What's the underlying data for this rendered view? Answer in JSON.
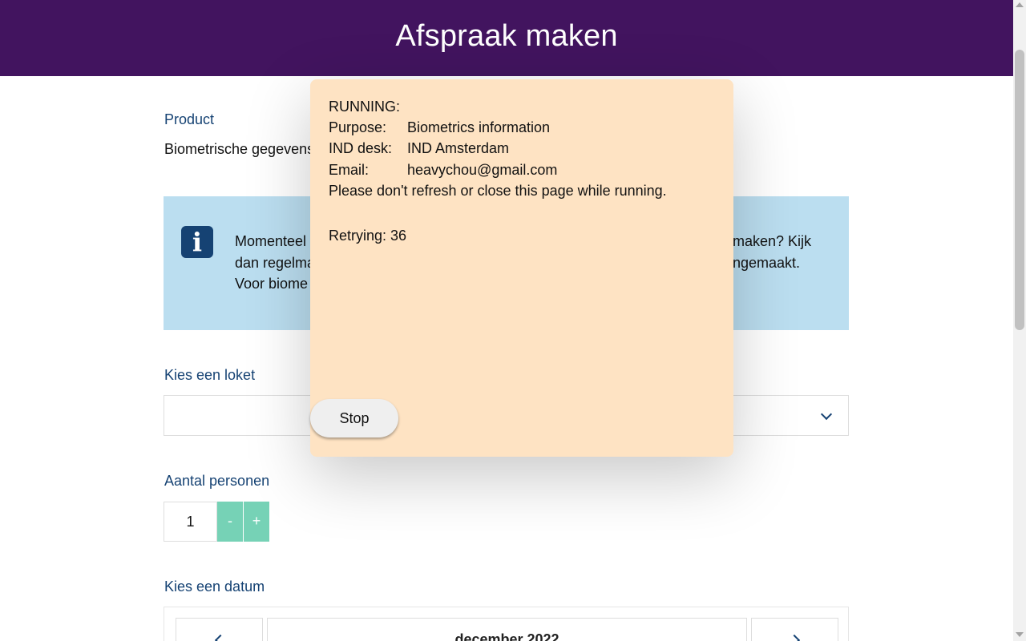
{
  "header": {
    "title": "Afspraak maken"
  },
  "form": {
    "product_label": "Product",
    "product_value": "Biometrische gegevens",
    "info_text_lines": [
      "Momenteel",
      "dan regelma",
      "Voor biome"
    ],
    "info_text_right_lines": [
      "maken? Kijk",
      "ngemaakt."
    ],
    "desk_label": "Kies een loket",
    "persons_label": "Aantal personen",
    "persons_value": "1",
    "minus_label": "-",
    "plus_label": "+",
    "date_label": "Kies een datum",
    "calendar_month": "december 2022"
  },
  "popup": {
    "status": "RUNNING:",
    "purpose_key": "Purpose:",
    "purpose_value": "Biometrics information",
    "desk_key": "IND desk:",
    "desk_value": "IND Amsterdam",
    "email_key": "Email:",
    "email_value": "heavychou@gmail.com",
    "warning": "Please don't refresh or close this page while running.",
    "retrying": "Retrying: 36",
    "stop_label": "Stop"
  },
  "icons": {
    "info": "info-icon",
    "select_arrow": "chevron-down-icon",
    "prev": "chevron-left-icon",
    "next": "chevron-right-icon"
  },
  "colors": {
    "header_bg": "#42145f",
    "info_bg": "#bbdef0",
    "label_color": "#154273",
    "stepper_bg": "#76d2b6",
    "popup_bg": "#fee3c3"
  }
}
